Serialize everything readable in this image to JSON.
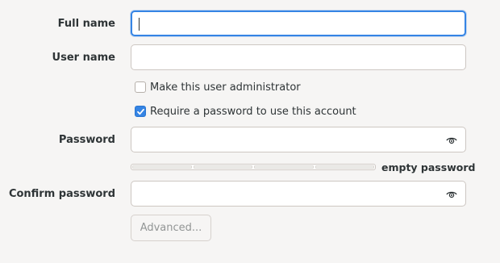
{
  "form": {
    "full_name": {
      "label": "Full name",
      "value": ""
    },
    "user_name": {
      "label": "User name",
      "value": ""
    },
    "administrator": {
      "label": "Make this user administrator",
      "checked": false
    },
    "require_password": {
      "label": "Require a password to use this account",
      "checked": true
    },
    "password": {
      "label": "Password",
      "value": "",
      "reveal_icon": "eye-icon"
    },
    "strength": {
      "text": "empty password",
      "level": 0,
      "segments": 4
    },
    "confirm_password": {
      "label": "Confirm password",
      "value": "",
      "reveal_icon": "eye-icon"
    },
    "advanced_button": {
      "label": "Advanced...",
      "enabled": false
    }
  },
  "colors": {
    "accent": "#3584e4",
    "background": "#f6f5f4",
    "disabled_text": "#929595"
  }
}
